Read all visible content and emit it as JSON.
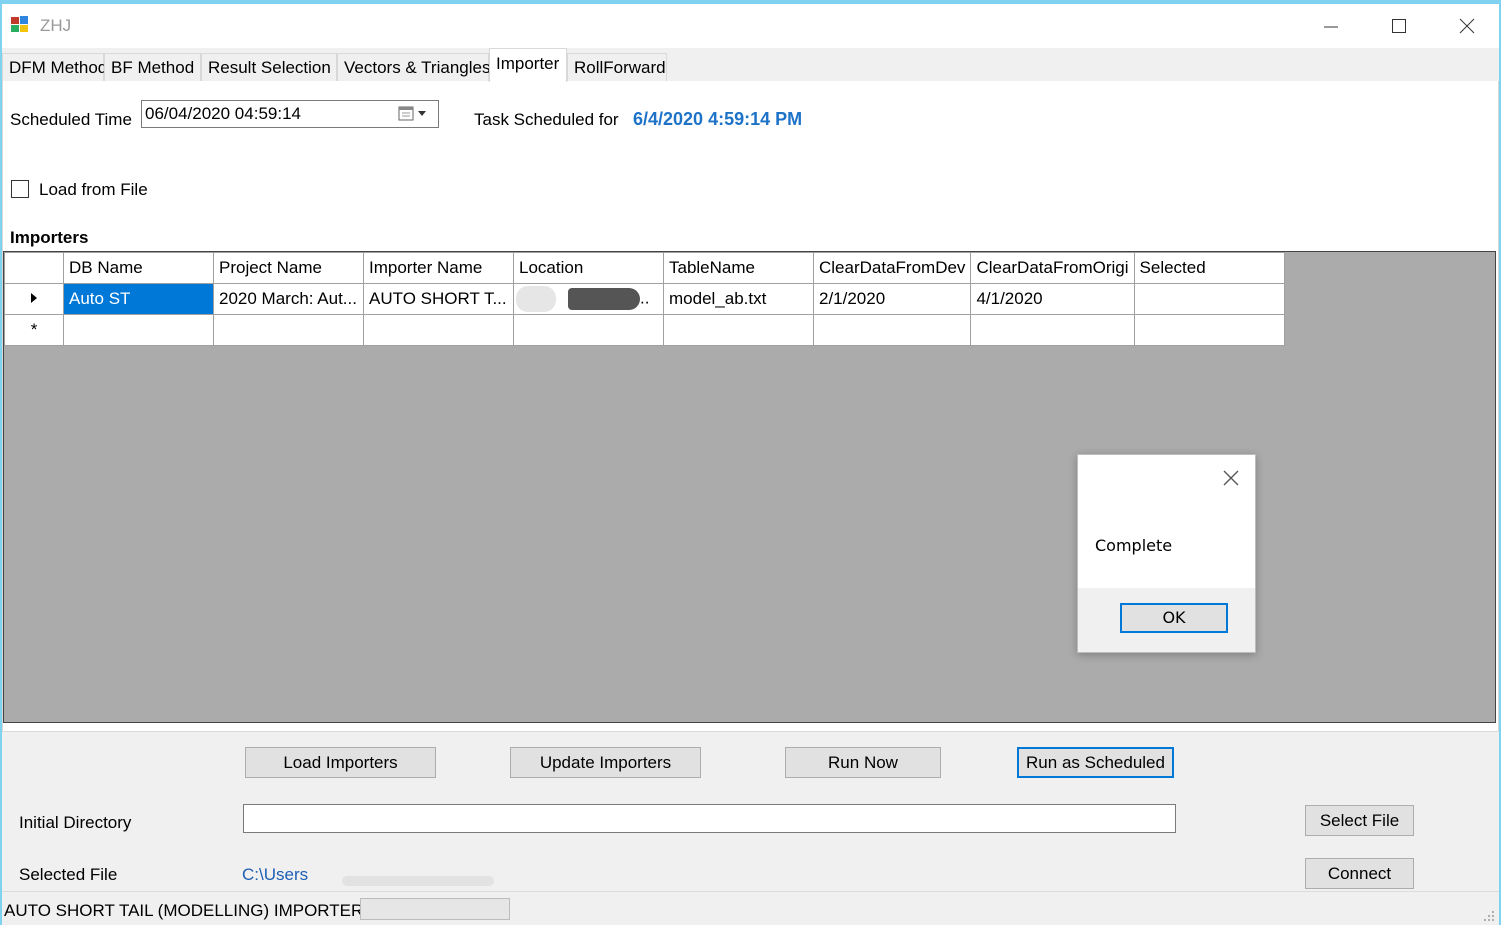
{
  "window": {
    "title": "ZHJ"
  },
  "tabs": [
    {
      "label": "DFM Method"
    },
    {
      "label": "BF Method"
    },
    {
      "label": "Result Selection"
    },
    {
      "label": "Vectors & Triangles"
    },
    {
      "label": "Importer",
      "active": true
    },
    {
      "label": "RollForward"
    }
  ],
  "schedule": {
    "label": "Scheduled Time",
    "value": "06/04/2020 04:59:14",
    "task_label": "Task Scheduled for",
    "task_value": "6/4/2020 4:59:14 PM"
  },
  "load_from_file": {
    "label": "Load from File",
    "checked": false
  },
  "importers": {
    "heading": "Importers",
    "columns": [
      "DB Name",
      "Project Name",
      "Importer Name",
      "Location",
      "TableName",
      "ClearDataFromDev",
      "ClearDataFromOrigi",
      "Selected"
    ],
    "rows": [
      [
        "Auto ST",
        "2020 March: Aut...",
        "AUTO SHORT T...",
        "..",
        "model_ab.txt",
        "2/1/2020",
        "4/1/2020",
        ""
      ]
    ],
    "new_row_marker": "*"
  },
  "dialog": {
    "message": "Complete",
    "ok_label": "OK"
  },
  "buttons": {
    "load_importers": "Load Importers",
    "update_importers": "Update Importers",
    "run_now": "Run Now",
    "run_as_scheduled": "Run as Scheduled",
    "select_file": "Select File",
    "connect": "Connect"
  },
  "initial_directory": {
    "label": "Initial Directory",
    "value": ""
  },
  "selected_file": {
    "label": "Selected File",
    "value": "C:\\Users"
  },
  "status": {
    "text": "AUTO SHORT TAIL (MODELLING) IMPORTER",
    "progress": 0
  },
  "colors": {
    "accent": "#0078d7",
    "link": "#1e5fb4",
    "task_value": "#1e73c8"
  }
}
